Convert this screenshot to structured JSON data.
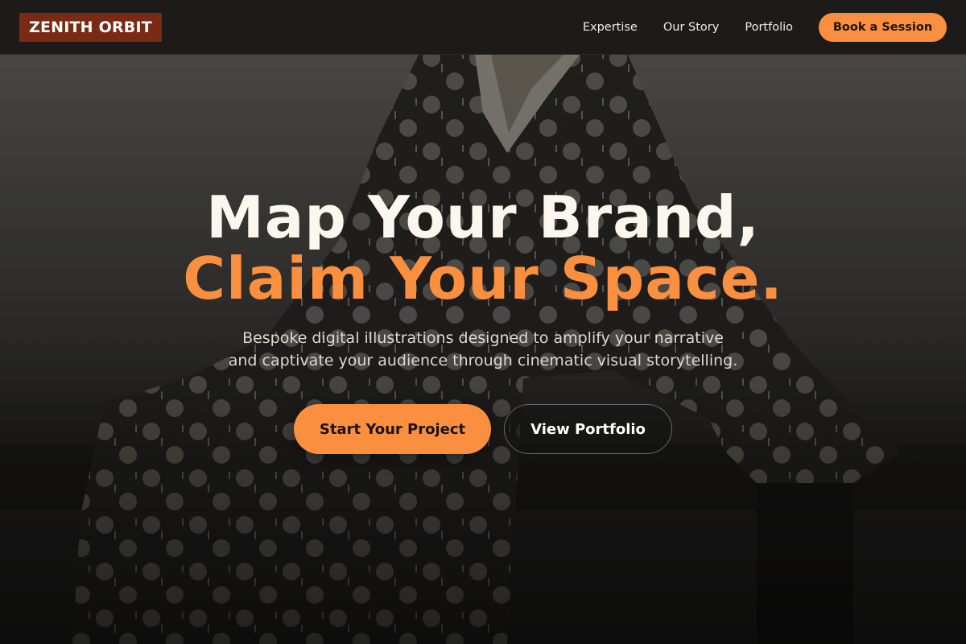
{
  "nav": {
    "logo": "ZENITH ORBIT",
    "links": [
      {
        "label": "Expertise"
      },
      {
        "label": "Our Story"
      },
      {
        "label": "Portfolio"
      }
    ],
    "cta": "Book a Session"
  },
  "hero": {
    "headline_line1": "Map Your Brand,",
    "headline_line2": "Claim Your Space.",
    "subtitle_line1": "Bespoke digital illustrations designed to amplify your narrative",
    "subtitle_line2": "and captivate your audience through cinematic visual storytelling.",
    "primary_cta": "Start Your Project",
    "secondary_cta": "View Portfolio",
    "background_icon": "robed-figure-illustration"
  },
  "colors": {
    "accent": "#fa8f3f",
    "logo_bg": "#7a2a12",
    "nav_bg": "#1c1b1a",
    "headline_text": "#fbf7ee"
  }
}
